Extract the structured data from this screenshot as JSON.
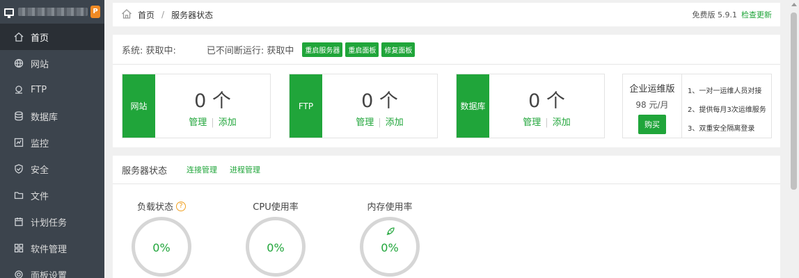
{
  "sidebar": {
    "items": [
      {
        "label": "首页",
        "icon": "home-icon"
      },
      {
        "label": "网站",
        "icon": "globe-icon"
      },
      {
        "label": "FTP",
        "icon": "ftp-icon"
      },
      {
        "label": "数据库",
        "icon": "database-icon"
      },
      {
        "label": "监控",
        "icon": "monitor-icon"
      },
      {
        "label": "安全",
        "icon": "shield-icon"
      },
      {
        "label": "文件",
        "icon": "folder-icon"
      },
      {
        "label": "计划任务",
        "icon": "calendar-icon"
      },
      {
        "label": "软件管理",
        "icon": "grid-icon"
      },
      {
        "label": "面板设置",
        "icon": "gear-icon"
      }
    ],
    "badge": "P"
  },
  "topbar": {
    "home": "首页",
    "separator": "/",
    "current": "服务器状态",
    "version": "免费版 5.9.1",
    "update_link": "检查更新"
  },
  "system": {
    "system_text": "系统: 获取中:",
    "uptime_text": "已不间断运行: 获取中",
    "buttons": [
      "重启服务器",
      "重启面板",
      "修复面板"
    ]
  },
  "cards": [
    {
      "tag": "网站",
      "count": "0 个",
      "manage": "管理",
      "add": "添加"
    },
    {
      "tag": "FTP",
      "count": "0 个",
      "manage": "管理",
      "add": "添加"
    },
    {
      "tag": "数据库",
      "count": "0 个",
      "manage": "管理",
      "add": "添加"
    }
  ],
  "promo": {
    "title": "企业运维版",
    "price": "98 元/月",
    "buy": "购买",
    "features": [
      "1、一对一运维人员对接",
      "2、提供每月3次运维服务",
      "3、双重安全隔离登录"
    ]
  },
  "server_status": {
    "title": "服务器状态",
    "links": [
      "连接管理",
      "进程管理"
    ],
    "gauges": [
      {
        "label": "负载状态",
        "value": "0%",
        "help": "?"
      },
      {
        "label": "CPU使用率",
        "value": "0%"
      },
      {
        "label": "内存使用率",
        "value": "0%"
      }
    ]
  },
  "colors": {
    "accent": "#20a53a",
    "sidebar": "#3c444d",
    "sidebar_active": "#2a2f35"
  }
}
